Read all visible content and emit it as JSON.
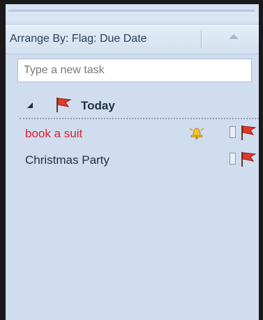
{
  "arrange": {
    "label": "Arrange By: Flag: Due Date",
    "sort_icon": "sort-up-arrow-icon"
  },
  "new_task": {
    "placeholder": "Type a new task",
    "value": ""
  },
  "group": {
    "title": "Today",
    "collapse_icon": "collapse-triangle-icon",
    "flag_icon": "red-flag-icon"
  },
  "tasks": [
    {
      "subject": "book a suit",
      "subject_color": "#e0202a",
      "reminder_icon": "reminder-bell-icon",
      "completed": false,
      "flag_icon": "red-flag-icon"
    },
    {
      "subject": "Christmas Party",
      "subject_color": "#1f2f45",
      "completed": false,
      "flag_icon": "red-flag-icon"
    }
  ],
  "colors": {
    "pane_background": "#cfddee",
    "flag_red": "#e03a2a",
    "overdue_text": "#e0202a"
  }
}
